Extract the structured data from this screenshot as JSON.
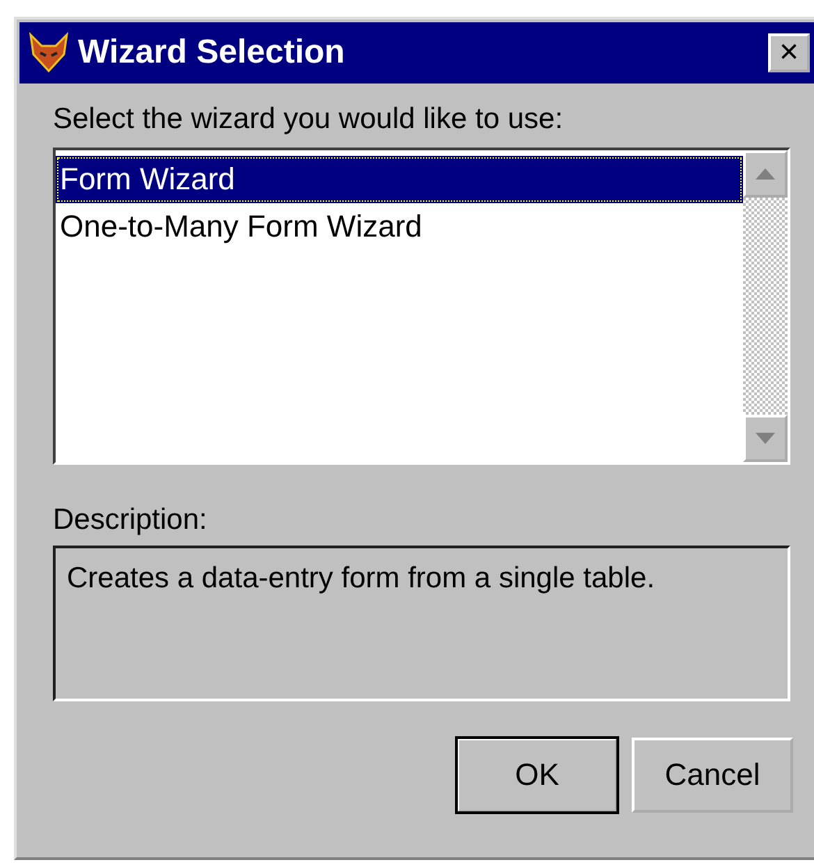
{
  "window": {
    "title": "Wizard Selection",
    "close": "×"
  },
  "prompt": "Select the wizard you would like to use:",
  "wizards": [
    {
      "label": "Form Wizard",
      "selected": true
    },
    {
      "label": "One-to-Many Form Wizard",
      "selected": false
    }
  ],
  "description": {
    "label": "Description:",
    "text": "Creates a data-entry form from a single table."
  },
  "buttons": [
    {
      "label": "OK",
      "default": true
    },
    {
      "label": "Cancel",
      "default": false
    }
  ]
}
